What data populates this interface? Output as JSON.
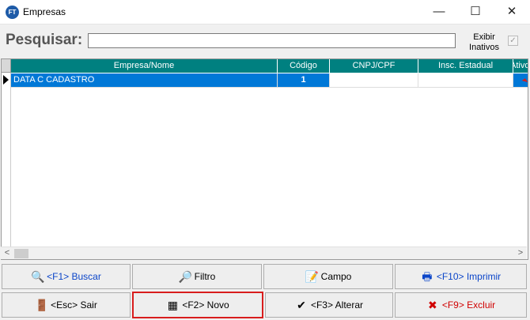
{
  "window": {
    "icon_text": "FT",
    "title": "Empresas",
    "min_glyph": "—",
    "max_glyph": "☐",
    "close_glyph": "✕"
  },
  "search": {
    "label": "Pesquisar:",
    "value": "",
    "placeholder": "",
    "exibir_line1": "Exibir",
    "exibir_line2": "Inativos",
    "exibir_checked": true,
    "check_glyph": "✓"
  },
  "grid": {
    "columns": [
      "Empresa/Nome",
      "Código",
      "CNPJ/CPF",
      "Insc. Estadual",
      "Ativo"
    ],
    "rows": [
      {
        "empresa": "DATA C CADASTRO",
        "codigo": "1",
        "cnpj": "",
        "insc": "",
        "ativo": ""
      }
    ],
    "selection_color": "#0078d7",
    "header_color": "#008080"
  },
  "scrollbar": {
    "left_glyph": "<",
    "right_glyph": ">"
  },
  "buttons": {
    "buscar": {
      "label": "<F1> Buscar",
      "icon": "search-document-icon",
      "glyph": "🔍"
    },
    "filtro": {
      "label": "Filtro",
      "icon": "filter-icon",
      "glyph": "🔎"
    },
    "campo": {
      "label": "Campo",
      "icon": "field-edit-icon",
      "glyph": "📝"
    },
    "imprimir": {
      "label": "<F10> Imprimir",
      "icon": "printer-icon",
      "glyph": "🖶"
    },
    "sair": {
      "label": "<Esc> Sair",
      "icon": "exit-door-icon",
      "glyph": "🚪"
    },
    "novo": {
      "label": "<F2> Novo",
      "icon": "new-record-icon",
      "glyph": "▦"
    },
    "alterar": {
      "label": "<F3> Alterar",
      "icon": "edit-check-icon",
      "glyph": "✔"
    },
    "excluir": {
      "label": "<F9> Excluir",
      "icon": "delete-icon",
      "glyph": "✖"
    }
  }
}
